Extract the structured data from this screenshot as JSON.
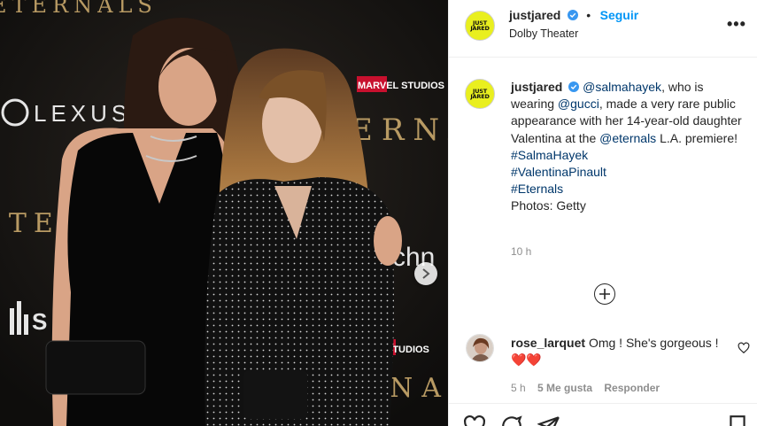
{
  "photo": {
    "backdrop_texts": {
      "top": "ETERNALS",
      "lexus": "LEXUS",
      "marvel": "MARVEL STUDIOS",
      "left": "ETERNALS",
      "right": "ERNA",
      "sky": "S",
      "rt": "chn",
      "marvel_small": "STUDIOS",
      "bottom_right": "NA"
    }
  },
  "header": {
    "avatar_text": "JUST\nJARED",
    "username": "justjared",
    "follow_label": "Seguir",
    "separator": "•",
    "location": "Dolby Theater",
    "more_label": "•••"
  },
  "caption": {
    "username": "justjared",
    "mention_salma": "@salmahayek",
    "text1": ", who is wearing ",
    "mention_gucci": "@gucci",
    "text2": ", made a very rare public appearance with her 14-year-old daughter Valentina at the ",
    "mention_eternals": "@eternals",
    "text3": " L.A. premiere!",
    "hashtags": [
      "#SalmaHayek",
      "#ValentinaPinault",
      "#Eternals"
    ],
    "credit": "Photos: Getty",
    "time": "10 h"
  },
  "comment": {
    "username": "rose_larquet",
    "text": "Omg ! She's gorgeous ! ",
    "emoji": "❤️❤️",
    "time": "5 h",
    "likes": "5 Me gusta",
    "reply_label": "Responder"
  },
  "colors": {
    "follow": "#0095f6",
    "link": "#00376b",
    "avatar_bg": "#e9ef1f",
    "verified": "#3897f0",
    "heart": "#ed4956"
  }
}
